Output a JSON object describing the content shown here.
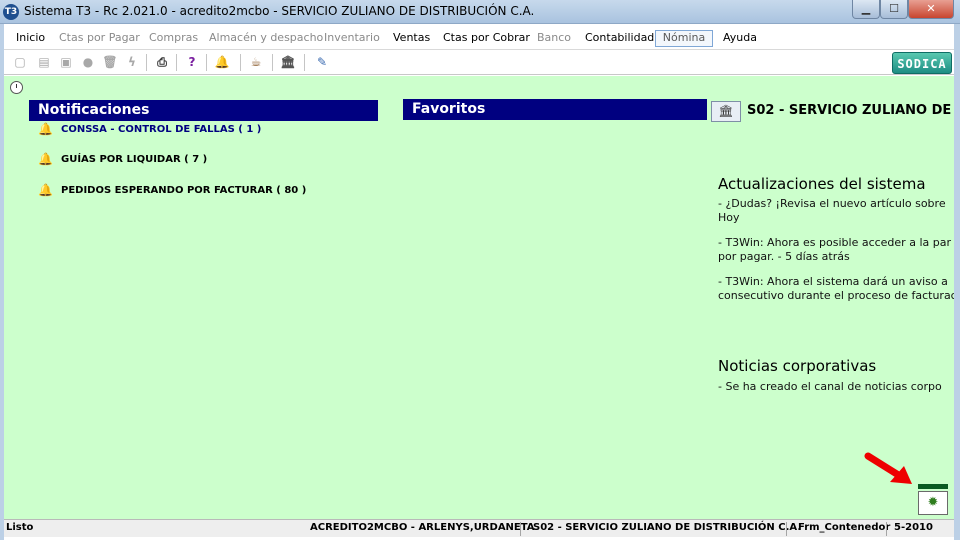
{
  "window": {
    "app_icon": "T3",
    "title": "Sistema T3 - Rc 2.021.0 - acredito2mcbo - SERVICIO ZULIANO DE DISTRIBUCIÓN C.A.",
    "minimize_icon": "minimize-icon",
    "maximize_icon": "maximize-icon",
    "close_icon": "close-icon"
  },
  "menu": {
    "items": [
      {
        "label": "Inicio",
        "state": "enabled"
      },
      {
        "label": "Ctas por Pagar",
        "state": "disabled"
      },
      {
        "label": "Compras",
        "state": "disabled"
      },
      {
        "label": "Almacén y despacho",
        "state": "disabled"
      },
      {
        "label": "Inventario",
        "state": "disabled"
      },
      {
        "label": "Ventas",
        "state": "enabled"
      },
      {
        "label": "Ctas por Cobrar",
        "state": "enabled"
      },
      {
        "label": "Banco",
        "state": "disabled"
      },
      {
        "label": "Contabilidad",
        "state": "enabled"
      },
      {
        "label": "Nómina",
        "state": "selected"
      },
      {
        "label": "Ayuda",
        "state": "enabled"
      }
    ]
  },
  "toolbar": {
    "icons": [
      "new-icon",
      "edit-icon",
      "save-icon",
      "record-icon",
      "delete-icon",
      "flash-icon",
      "print-icon",
      "help-icon",
      "notifications-bell-icon",
      "coffee-icon",
      "bank-icon",
      "tools-icon"
    ],
    "brand_logo": "SODICA"
  },
  "notifications": {
    "title": "Notificaciones",
    "items": [
      {
        "label": "CONSSA - CONTROL DE FALLAS ( 1 )"
      },
      {
        "label": "GUÍAS POR LIQUIDAR ( 7 )"
      },
      {
        "label": "PEDIDOS ESPERANDO POR FACTURAR ( 80 )"
      }
    ]
  },
  "favorites": {
    "title": "Favoritos"
  },
  "company": {
    "title": "S02 - SERVICIO ZULIANO DE"
  },
  "system_updates": {
    "title": "Actualizaciones del sistema",
    "items": [
      {
        "line1": " - ¿Dudas? ¡Revisa el nuevo artículo sobre",
        "line2": "Hoy"
      },
      {
        "line1": " - T3Win: Ahora es posible acceder a la par",
        "line2": "por pagar. - 5 días atrás"
      },
      {
        "line1": " - T3Win: Ahora el sistema dará un aviso a",
        "line2": "consecutivo durante el proceso de facturac"
      }
    ]
  },
  "corporate_news": {
    "title": "Noticias corporativas",
    "items": [
      {
        "line1": " - Se ha creado el canal de noticias corpo"
      }
    ]
  },
  "statusbar": {
    "status": "Listo",
    "user": "ACREDITO2MCBO - ARLENYS,URDANETA",
    "company": "S02 - SERVICIO ZULIANO DE DISTRIBUCIÓN C.A.",
    "form": "Frm_Contenedor",
    "period": "5-2010"
  },
  "colors": {
    "content_bg": "#ccffcc",
    "panel_header_bg": "#000080",
    "annotation_arrow": "#ee0000"
  }
}
